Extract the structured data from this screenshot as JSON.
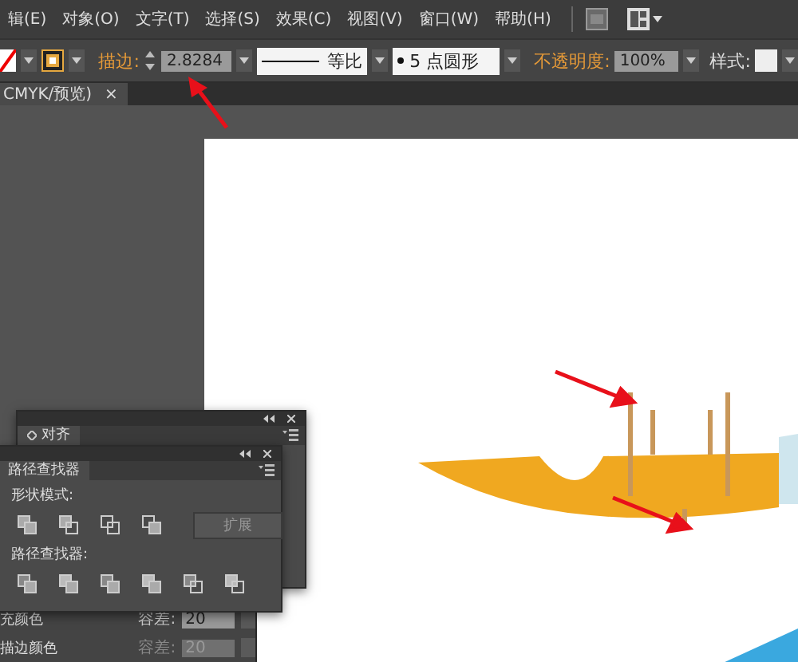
{
  "menu": [
    "辑(E)",
    "对象(O)",
    "文字(T)",
    "选择(S)",
    "效果(C)",
    "视图(V)",
    "窗口(W)",
    "帮助(H)"
  ],
  "control_bar": {
    "stroke_label": "描边:",
    "stroke_weight": "2.8284",
    "stroke_profile": "等比",
    "brush": "5 点圆形",
    "opacity_label": "不透明度:",
    "opacity": "100%",
    "style_label": "样式:"
  },
  "document_tab": {
    "title": "CMYK/预览)",
    "close": "×"
  },
  "align_panel": {
    "tab": "对齐"
  },
  "pathfinder_panel": {
    "tab": "路径查找器",
    "shape_modes_label": "形状模式:",
    "expand_button": "扩展",
    "pathfinders_label": "路径查找器:"
  },
  "lower_panel": {
    "rows": [
      {
        "label": "充颜色",
        "tolerance_label": "容差:",
        "tolerance": "20",
        "disabled": false
      },
      {
        "label": "描边颜色",
        "tolerance_label": "容差:",
        "tolerance": "20",
        "disabled": true
      }
    ]
  }
}
